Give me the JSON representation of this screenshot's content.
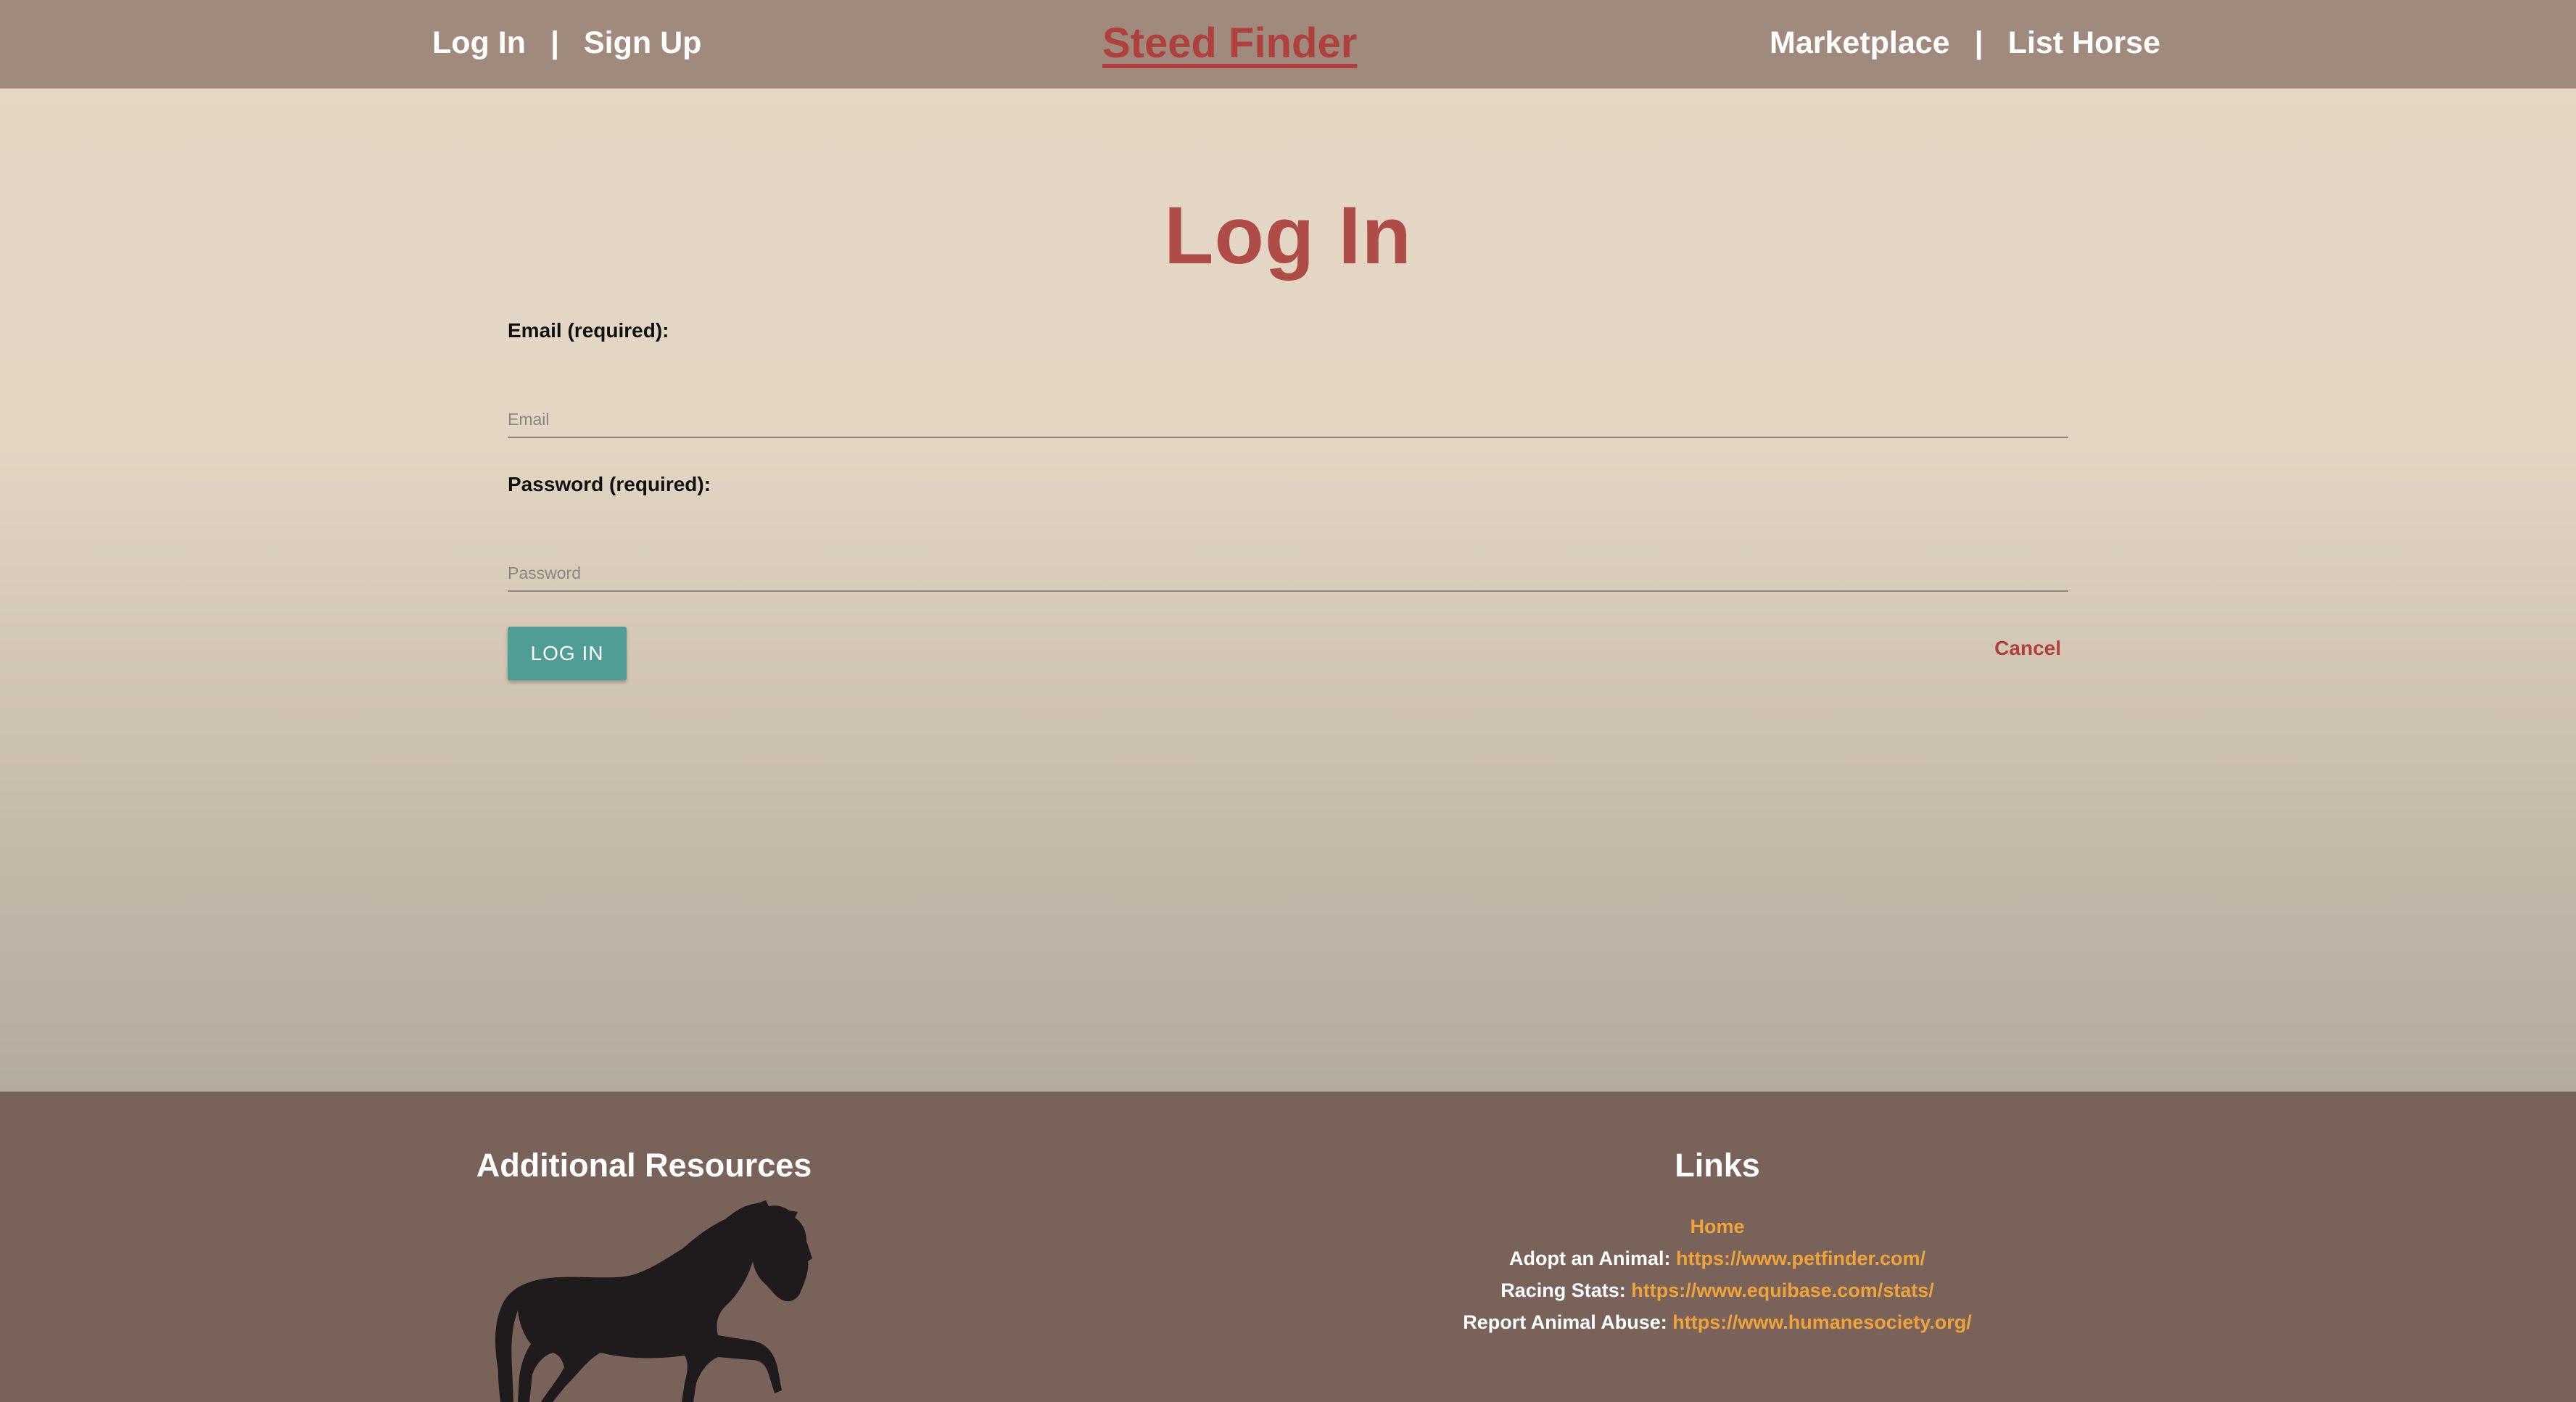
{
  "header": {
    "nav_left": {
      "login": "Log In",
      "separator": "|",
      "signup": "Sign Up"
    },
    "brand": "Steed Finder",
    "nav_right": {
      "marketplace": "Marketplace",
      "separator": "|",
      "list_horse": "List Horse"
    }
  },
  "main": {
    "title": "Log In",
    "email": {
      "label": "Email (required):",
      "placeholder": "Email",
      "value": ""
    },
    "password": {
      "label": "Password (required):",
      "placeholder": "Password",
      "value": ""
    },
    "login_button": "LOG IN",
    "cancel_link": "Cancel"
  },
  "footer": {
    "resources_title": "Additional Resources",
    "horse_image": "horse-silhouette-icon",
    "links_title": "Links",
    "links": [
      {
        "label": "",
        "link": "Home"
      },
      {
        "label": "Adopt an Animal:",
        "link": "https://www.petfinder.com/"
      },
      {
        "label": "Racing Stats:",
        "link": "https://www.equibase.com/stats/"
      },
      {
        "label": "Report Animal Abuse:",
        "link": "https://www.humanesociety.org/"
      }
    ]
  },
  "colors": {
    "header_bg": "#a08a7e",
    "brand": "#b0403c",
    "title": "#b04c47",
    "button": "#4f9d94",
    "footer_bg": "#786259",
    "footer_link": "#f0a33a"
  }
}
